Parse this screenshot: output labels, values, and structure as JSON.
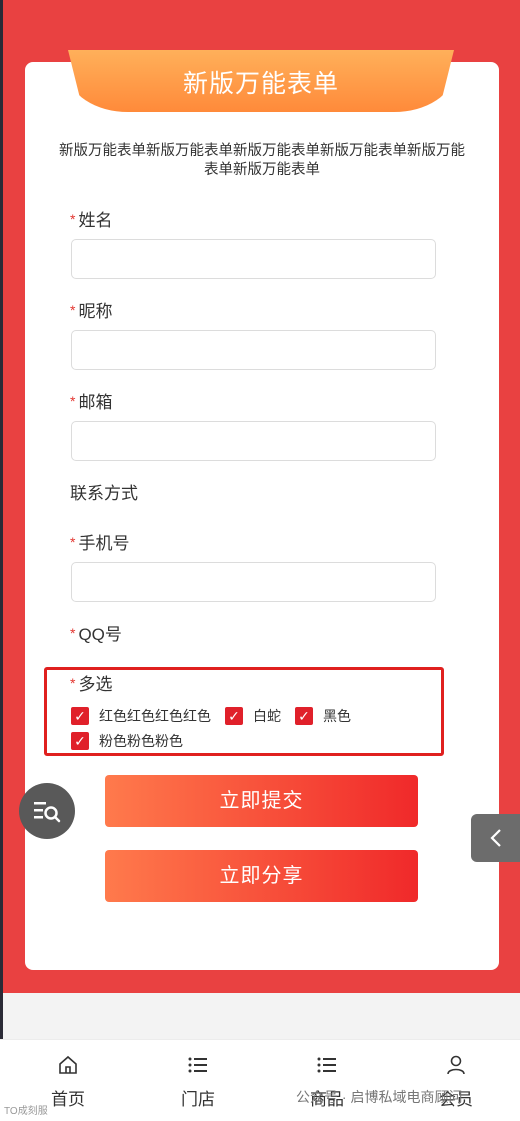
{
  "form": {
    "title": "新版万能表单",
    "description": "新版万能表单新版万能表单新版万能表单新版万能表单新版万能表单新版万能表单",
    "required_mark": "*",
    "fields": {
      "name_label": "姓名",
      "nickname_label": "昵称",
      "email_label": "邮箱",
      "contact_section": "联系方式",
      "phone_label": "手机号",
      "qq_label": "QQ号",
      "multi_label": "多选"
    },
    "options": [
      "红色红色红色红色",
      "白蛇",
      "黑色",
      "粉色粉色粉色"
    ],
    "checkmark": "✓",
    "submit_label": "立即提交",
    "share_label": "立即分享"
  },
  "tabbar": {
    "items": [
      {
        "label": "首页",
        "icon": "home-icon"
      },
      {
        "label": "门店",
        "icon": "list-icon"
      },
      {
        "label": "商品",
        "icon": "list-icon"
      },
      {
        "label": "会员",
        "icon": "user-icon"
      }
    ]
  },
  "watermark": {
    "text": "公众号 · 启博私域电商顾问",
    "small": "TO成刻服"
  },
  "colors": {
    "background_red": "#e94141",
    "banner_orange": "#ff9a45",
    "button_start": "#ff7a4c",
    "button_end": "#f0292a",
    "checkbox_red": "#e0202a",
    "highlight_border": "#e0201f"
  }
}
